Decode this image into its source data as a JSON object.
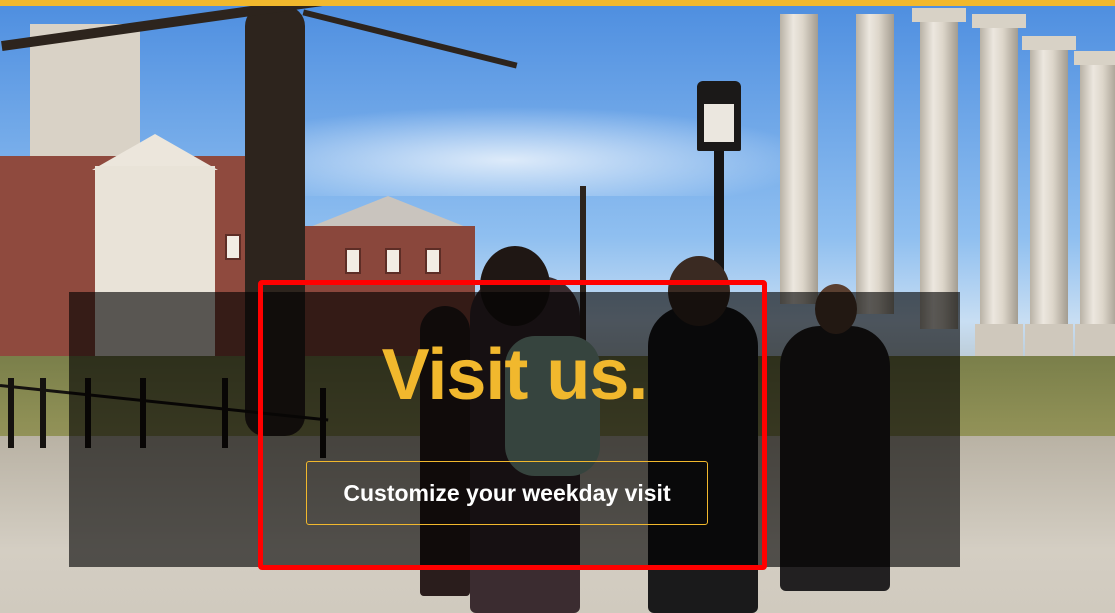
{
  "hero": {
    "heading": "Visit us.",
    "cta_label": "Customize your weekday visit",
    "background_image": "campus-columns-photo"
  },
  "colors": {
    "accent_gold": "#f1b82d",
    "overlay": "rgba(0,0,0,0.62)",
    "highlight_red": "#ff0000",
    "button_text": "#ffffff"
  }
}
